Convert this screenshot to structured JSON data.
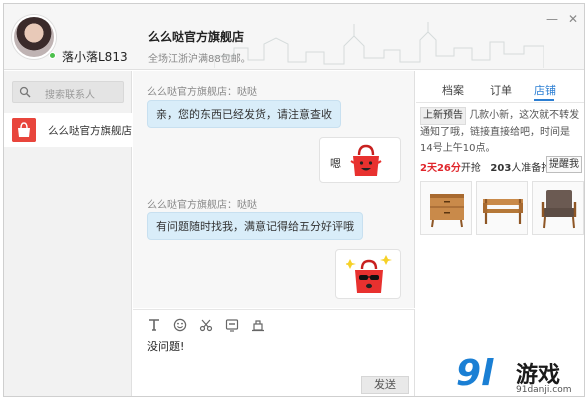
{
  "header": {
    "user_name": "落小落L813",
    "shop_name": "么么哒官方旗舰店",
    "shop_subtitle": "全场江浙沪满88包邮。",
    "minimize_glyph": "—",
    "close_glyph": "✕"
  },
  "sidebar": {
    "search_placeholder": "搜索联系人",
    "contacts": [
      {
        "name": "么么哒官方旗舰店",
        "icon": "shop-bag-icon"
      }
    ]
  },
  "chat": {
    "messages": [
      {
        "sender": "么么哒官方旗舰店：哒哒",
        "text": "亲，您的东西已经发货，请注意查收"
      },
      {
        "sender": "self",
        "text": "嗯",
        "sticker": "red-bag-smile-sticker"
      },
      {
        "sender": "么么哒官方旗舰店：哒哒",
        "text": "有问题随时找我，满意记得给五分好评哦"
      },
      {
        "sender": "self",
        "text": "",
        "sticker": "red-bag-sunglasses-sticker"
      }
    ]
  },
  "composer": {
    "tools": [
      "font-icon",
      "emoji-icon",
      "scissors-icon",
      "screenshot-icon",
      "shake-icon"
    ],
    "text": "没问题!",
    "send_label": "发送"
  },
  "right_panel": {
    "tabs": [
      "档案",
      "订单",
      "店铺"
    ],
    "active_tab": "店铺",
    "promo_tag": "上新预告",
    "promo_text": "几款小新，这次就不转发通知了哦，链接直接给吧，时间是14号上午10点。",
    "countdown_time": "2天26分",
    "countdown_suffix": "开抢",
    "waiting_count": "203",
    "waiting_text": "人准备抢",
    "remind_label": "提醒我",
    "products": [
      "wooden-cabinet",
      "wooden-bench",
      "armchair"
    ]
  },
  "watermark": {
    "logo_digits": "9l",
    "name": "游戏",
    "url": "91danji.com"
  },
  "colors": {
    "accent": "#2d7fd3",
    "bubble": "#d9edf9",
    "countdown_red": "#e0262c",
    "online": "#4cc04c"
  }
}
